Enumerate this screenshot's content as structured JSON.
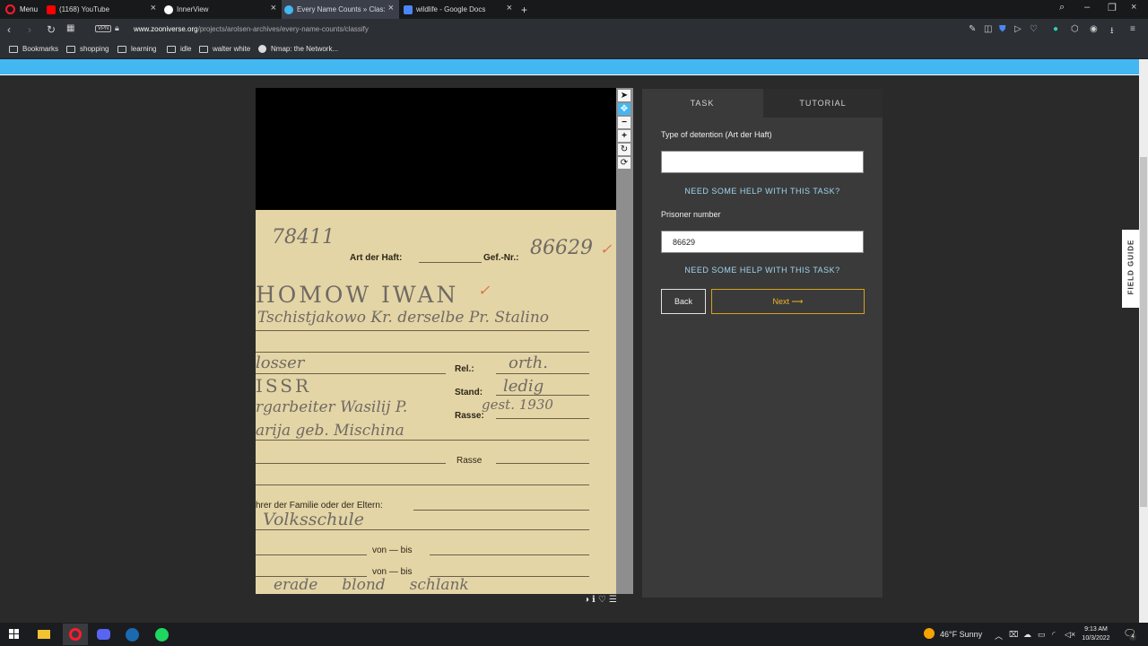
{
  "browser": {
    "menu_label": "Menu",
    "tabs": [
      {
        "title": "(1168) YouTube",
        "icon_color": "#ff0000"
      },
      {
        "title": "InnerView",
        "icon_color": "#ffffff"
      },
      {
        "title": "Every Name Counts » Clas:",
        "icon_color": "#43b7f2",
        "active": true
      },
      {
        "title": "wildlife - Google Docs",
        "icon_color": "#4a86f5"
      }
    ],
    "new_tab": "+",
    "vpn_label": "VPN",
    "url_host": "www.zooniverse.org",
    "url_path": "/projects/arolsen-archives/every-name-counts/classify"
  },
  "bookmarks": [
    {
      "label": "Bookmarks"
    },
    {
      "label": "shopping"
    },
    {
      "label": "learning"
    },
    {
      "label": "idle"
    },
    {
      "label": "walter white"
    },
    {
      "label": "Nmap: the Network..."
    }
  ],
  "document": {
    "hw_number_top": "78411",
    "printed_art": "Art der Haft:",
    "printed_gef": "Gef.-Nr.:",
    "hw_gef_number": "86629",
    "check_mark": "✓",
    "hw_name": "HOMOW IWAN",
    "hw_birthplace": "Tschistjakowo Kr. derselbe Pr. Stalino",
    "hw_occupation": "losser",
    "printed_rel": "Rel.:",
    "hw_rel": "orth.",
    "hw_nation": "ISSR",
    "printed_stand": "Stand:",
    "hw_stand": "ledig",
    "hw_father": "rgarbeiter Wasilij P.",
    "printed_rasse1": "Rasse:",
    "hw_gest": "gest. 1930",
    "hw_mother": "arija geb. Mischina",
    "printed_rasse2": "Rasse",
    "printed_family": "hrer der Familie oder der Eltern:",
    "hw_school": "Volksschule",
    "printed_von1": "von — bis",
    "printed_von2": "von — bis",
    "hw_bottom": "erade     blond     schlank"
  },
  "task_panel": {
    "tab_task": "TASK",
    "tab_tutorial": "TUTORIAL",
    "q1_label": "Type of detention (Art der Haft)",
    "q1_value": "",
    "help_text": "NEED SOME HELP WITH THIS TASK?",
    "q2_label": "Prisoner number",
    "q2_value": "86629",
    "back_label": "Back",
    "next_label": "Next ⟶"
  },
  "field_guide_label": "FIELD GUIDE",
  "taskbar": {
    "weather": "46°F  Sunny",
    "time": "9:13 AM",
    "date": "10/3/2022",
    "notification_count": "4"
  },
  "colors": {
    "banner": "#43b7f2",
    "next_accent": "#f0b429",
    "help_link": "#9fd6f0"
  }
}
